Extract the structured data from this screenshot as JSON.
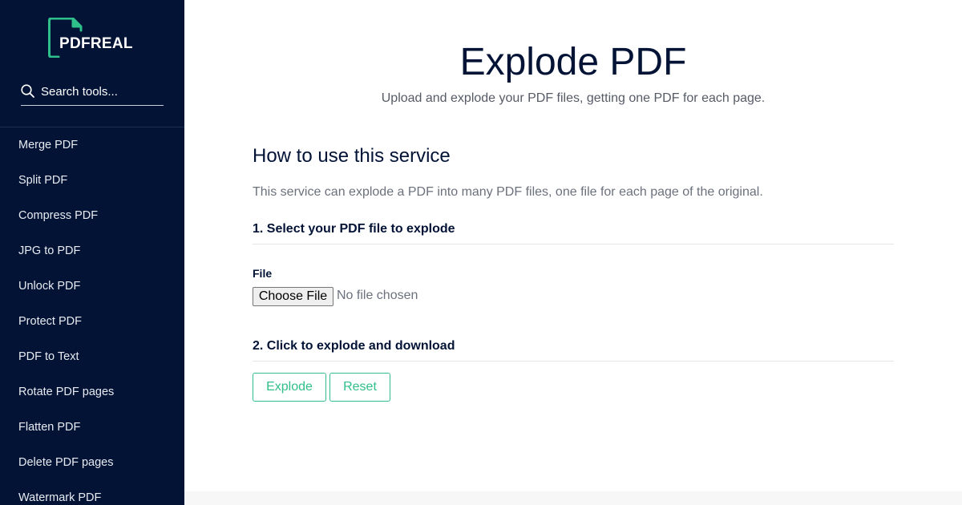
{
  "brand": {
    "name": "PDFREAL",
    "accent": "#2fbf8a",
    "sidebar_bg": "#021335"
  },
  "search": {
    "placeholder": "Search tools...",
    "icon": "search-icon"
  },
  "sidebar": {
    "items": [
      {
        "label": "Merge PDF"
      },
      {
        "label": "Split PDF"
      },
      {
        "label": "Compress PDF"
      },
      {
        "label": "JPG to PDF"
      },
      {
        "label": "Unlock PDF"
      },
      {
        "label": "Protect PDF"
      },
      {
        "label": "PDF to Text"
      },
      {
        "label": "Rotate PDF pages"
      },
      {
        "label": "Flatten PDF"
      },
      {
        "label": "Delete PDF pages"
      },
      {
        "label": "Watermark PDF"
      }
    ]
  },
  "header": {
    "title": "Explode PDF",
    "subtitle": "Upload and explode your PDF files, getting one PDF for each page."
  },
  "howto": {
    "title": "How to use this service",
    "description": "This service can explode a PDF into many PDF files, one file for each page of the original."
  },
  "step1": {
    "title": "1. Select your PDF file to explode",
    "file_label": "File",
    "choose_label": "Choose File",
    "status": "No file chosen"
  },
  "step2": {
    "title": "2. Click to explode and download",
    "explode_label": "Explode",
    "reset_label": "Reset"
  }
}
